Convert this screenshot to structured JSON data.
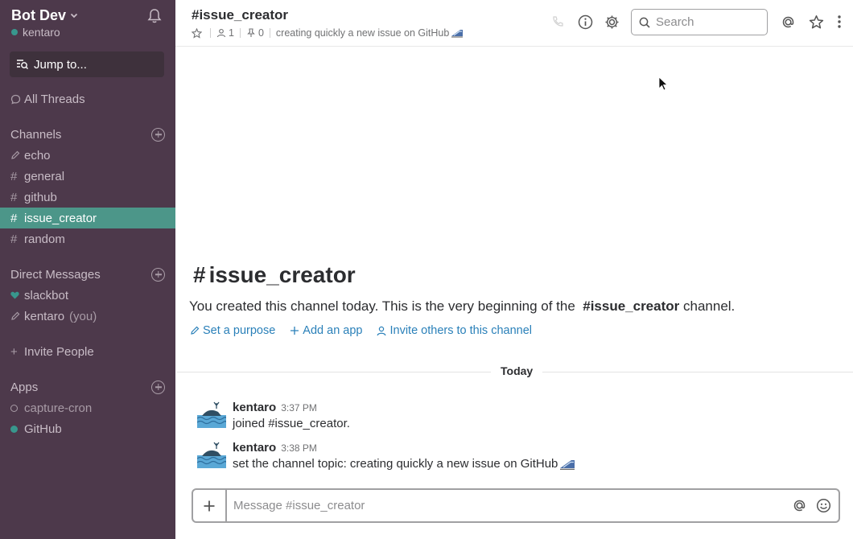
{
  "sidebar": {
    "team_name": "Bot Dev",
    "current_user": "kentaro",
    "jump_to": "Jump to...",
    "all_threads": "All Threads",
    "channels_header": "Channels",
    "channels": [
      {
        "prefix": "pencil",
        "name": "echo"
      },
      {
        "prefix": "#",
        "name": "general"
      },
      {
        "prefix": "#",
        "name": "github"
      },
      {
        "prefix": "#",
        "name": "issue_creator",
        "active": true
      },
      {
        "prefix": "#",
        "name": "random"
      }
    ],
    "dm_header": "Direct Messages",
    "dms": [
      {
        "name": "slackbot",
        "you": ""
      },
      {
        "name": "kentaro",
        "you": "(you)"
      }
    ],
    "invite_people": "Invite People",
    "apps_header": "Apps",
    "apps": [
      {
        "name": "capture-cron",
        "status": "away"
      },
      {
        "name": "GitHub",
        "status": "online"
      }
    ]
  },
  "header": {
    "channel_title": "#issue_creator",
    "members_count": "1",
    "pins_count": "0",
    "topic": "creating quickly a new issue on GitHub",
    "search_placeholder": "Search"
  },
  "intro": {
    "hash": "#",
    "title": "issue_creator",
    "text_before": "You created this channel today. This is the very beginning of the",
    "channel_ref": "#issue_creator",
    "text_after": "channel.",
    "actions": {
      "set_purpose": "Set a purpose",
      "add_app": "Add an app",
      "invite_others": "Invite others to this channel"
    }
  },
  "day_divider": "Today",
  "messages": [
    {
      "author": "kentaro",
      "time": "3:37 PM",
      "text": "joined #issue_creator."
    },
    {
      "author": "kentaro",
      "time": "3:38 PM",
      "text": "set the channel topic: creating quickly a new issue on GitHub"
    }
  ],
  "composer": {
    "placeholder": "Message #issue_creator"
  },
  "colors": {
    "sidebar_bg": "#4d394b",
    "active_channel": "#4c9689",
    "presence": "#38978d",
    "link": "#2a80b9"
  }
}
